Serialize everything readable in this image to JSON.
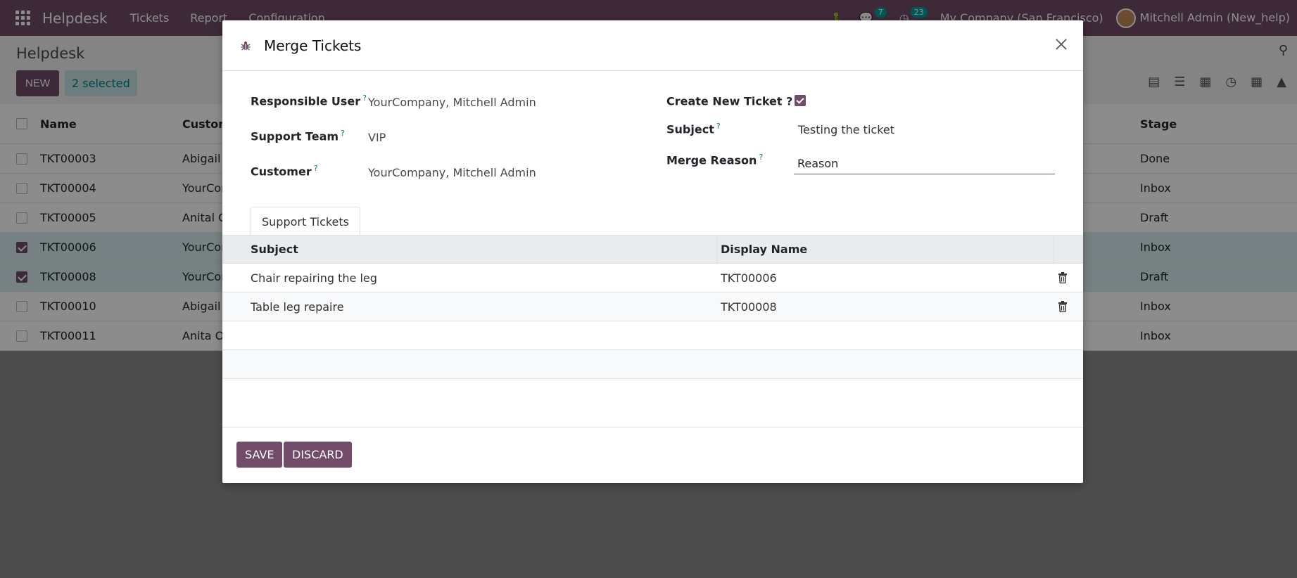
{
  "topbar": {
    "brand": "Helpdesk",
    "nav": [
      "Tickets",
      "Report",
      "Configuration"
    ],
    "chat_count": "7",
    "activity_count": "23",
    "company": "My Company (San Francisco)",
    "user": "Mitchell Admin (New_help)"
  },
  "control_panel": {
    "title": "Helpdesk",
    "new_label": "NEW",
    "selected_label": "2 selected"
  },
  "list": {
    "headers": {
      "name": "Name",
      "customer": "Custom",
      "stage": "Stage"
    },
    "rows": [
      {
        "name": "TKT00003",
        "customer": "Abigail I",
        "stage": "Done",
        "selected": false
      },
      {
        "name": "TKT00004",
        "customer": "YourCor",
        "stage": "Inbox",
        "selected": false
      },
      {
        "name": "TKT00005",
        "customer": "Anital O",
        "stage": "Draft",
        "selected": false
      },
      {
        "name": "TKT00006",
        "customer": "YourCor",
        "stage": "Inbox",
        "selected": true
      },
      {
        "name": "TKT00008",
        "customer": "YourCor",
        "stage": "Draft",
        "selected": true
      },
      {
        "name": "TKT00010",
        "customer": "Abigail I",
        "stage": "Inbox",
        "selected": false
      },
      {
        "name": "TKT00011",
        "customer": "Anita O",
        "stage": "Inbox",
        "selected": false
      }
    ]
  },
  "modal": {
    "title": "Merge Tickets",
    "fields": {
      "responsible_user_label": "Responsible User",
      "responsible_user_value": "YourCompany, Mitchell Admin",
      "support_team_label": "Support Team",
      "support_team_value": "VIP",
      "customer_label": "Customer",
      "customer_value": "YourCompany, Mitchell Admin",
      "create_new_label": "Create New Ticket ?",
      "create_new_checked": true,
      "subject_label": "Subject",
      "subject_value": "Testing the ticket",
      "merge_reason_label": "Merge Reason",
      "merge_reason_value": "Reason",
      "help_mark": "?"
    },
    "tab_label": "Support Tickets",
    "table": {
      "headers": [
        "Subject",
        "Display Name"
      ],
      "rows": [
        {
          "subject": "Chair repairing the leg",
          "display_name": "TKT00006"
        },
        {
          "subject": "Table leg repaire",
          "display_name": "TKT00008"
        }
      ]
    },
    "save_label": "SAVE",
    "discard_label": "DISCARD"
  },
  "colors": {
    "brand": "#714b67",
    "accent": "#017e84"
  },
  "icons": [
    "apps-icon",
    "bug-icon",
    "chat-icon",
    "clock-icon",
    "close-icon",
    "trash-icon",
    "search-icon"
  ]
}
